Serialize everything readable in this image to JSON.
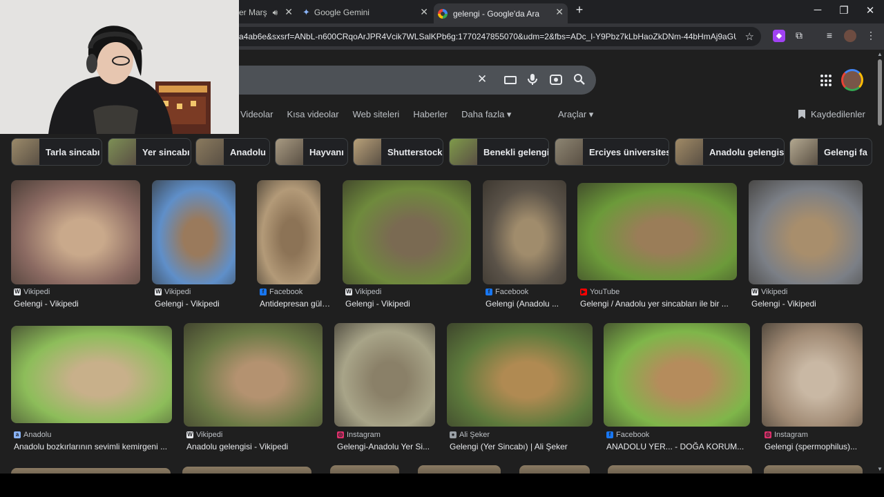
{
  "tabs": [
    {
      "label": "er Marş",
      "active": false,
      "icon": "speaker-icon"
    },
    {
      "label": "Google Gemini",
      "active": false,
      "icon": "gemini-icon"
    },
    {
      "label": "gelengi - Google'da Ara",
      "active": true,
      "icon": "google-icon"
    }
  ],
  "new_tab": "+",
  "window": {
    "minimize": "─",
    "maximize": "❐",
    "close": "✕"
  },
  "address": {
    "url": "a4ab6e&sxsrf=ANbL-n600CRqoArJPR4Vcik7WLSalKPb6g:1770247855070&udm=2&fbs=ADc_l-Y9Pbz7kLbHaoZkDNm-44bHmAj9aGUCfW..."
  },
  "search": {
    "clear": "✕"
  },
  "nav": {
    "tabs": [
      "Videolar",
      "Kısa videolar",
      "Web siteleri",
      "Haberler",
      "Daha fazla ▾"
    ],
    "tools": "Araçlar ▾",
    "saved": "Kaydedilenler"
  },
  "chips": [
    {
      "label": "Tarla sincabı",
      "color": "#9b8a6a"
    },
    {
      "label": "Yer sincabı",
      "color": "#7d8f55"
    },
    {
      "label": "Anadolu",
      "color": "#8a7a5e"
    },
    {
      "label": "Hayvanı",
      "color": "#a89a82"
    },
    {
      "label": "Shutterstock",
      "color": "#b8a079"
    },
    {
      "label": "Benekli gelengi",
      "color": "#7f9a4a"
    },
    {
      "label": "Erciyes üniversitesi",
      "color": "#8d8572"
    },
    {
      "label": "Anadolu gelengisi",
      "color": "#a08a66"
    },
    {
      "label": "Gelengi fa",
      "color": "#b3a890"
    }
  ],
  "results": [
    {
      "source": "Vikipedi",
      "title": "Gelengi - Vikipedi",
      "icon": "wikipedia-icon",
      "colors": [
        "#8b6a62",
        "#c9a98b"
      ]
    },
    {
      "source": "Vikipedi",
      "title": "Gelengi - Vikipedi",
      "icon": "wikipedia-icon",
      "colors": [
        "#5f8fc9",
        "#9a7a5c"
      ]
    },
    {
      "source": "Facebook",
      "title": "Antidepresan gülü...",
      "icon": "facebook-icon",
      "colors": [
        "#b39a78",
        "#8c7356"
      ]
    },
    {
      "source": "Vikipedi",
      "title": "Gelengi - Vikipedi",
      "icon": "wikipedia-icon",
      "colors": [
        "#6f8a3d",
        "#7a6a52"
      ]
    },
    {
      "source": "Facebook",
      "title": "Gelengi (Anadolu ...",
      "icon": "facebook-icon",
      "colors": [
        "#5a5248",
        "#a08c6c"
      ]
    },
    {
      "source": "YouTube",
      "title": "Gelengi / Anadolu yer sincabları ile bir ...",
      "icon": "youtube-icon",
      "colors": [
        "#6c9a3a",
        "#9a7d58"
      ]
    },
    {
      "source": "Vikipedi",
      "title": "Gelengi - Vikipedi",
      "icon": "wikipedia-icon",
      "colors": [
        "#7b7f86",
        "#a88e6c"
      ]
    },
    {
      "source": "Anadolu",
      "title": "Anadolu bozkırlarının sevimli kemirgeni ...",
      "icon": "anadolu-icon",
      "colors": [
        "#8dbd5a",
        "#c8b08a"
      ]
    },
    {
      "source": "Vikipedi",
      "title": "Anadolu gelengisi - Vikipedi",
      "icon": "wikipedia-icon",
      "colors": [
        "#6b7a45",
        "#b49270"
      ]
    },
    {
      "source": "Instagram",
      "title": "Gelengi-Anadolu Yer Si...",
      "icon": "instagram-icon",
      "colors": [
        "#a8a488",
        "#8a8068"
      ]
    },
    {
      "source": "Ali Şeker",
      "title": "Gelengi (Yer Sincabı) | Ali Şeker",
      "icon": "site-icon",
      "colors": [
        "#5d7a3c",
        "#b08a52"
      ]
    },
    {
      "source": "Facebook",
      "title": "ANADOLU YER... - DOĞA KORUM...",
      "icon": "facebook-icon",
      "colors": [
        "#7fb64a",
        "#b58c5c"
      ]
    },
    {
      "source": "Instagram",
      "title": "Gelengi (spermophilus)...",
      "icon": "instagram-icon",
      "colors": [
        "#a08a74",
        "#c9b8a4"
      ]
    }
  ]
}
